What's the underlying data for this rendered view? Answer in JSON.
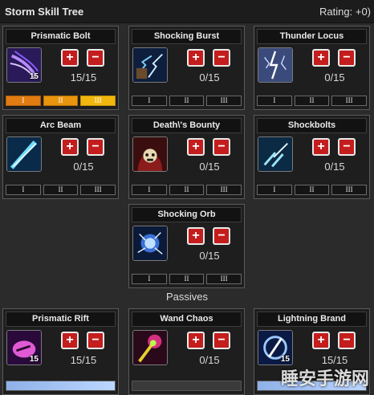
{
  "header": {
    "title": "Storm Skill Tree",
    "rating": "Rating: +0)"
  },
  "skills": [
    {
      "name": "Prismatic Bolt",
      "icon": "prismatic-bolt-icon",
      "level_badge": "15",
      "count": "15/15",
      "ranks": [
        "I",
        "II",
        "III"
      ],
      "ranks_active": [
        true,
        true,
        true
      ]
    },
    {
      "name": "Shocking Burst",
      "icon": "shocking-burst-icon",
      "level_badge": "",
      "count": "0/15",
      "ranks": [
        "I",
        "II",
        "III"
      ],
      "ranks_active": [
        false,
        false,
        false
      ]
    },
    {
      "name": "Thunder Locus",
      "icon": "thunder-locus-icon",
      "level_badge": "",
      "count": "0/15",
      "ranks": [
        "I",
        "II",
        "III"
      ],
      "ranks_active": [
        false,
        false,
        false
      ]
    },
    {
      "name": "Arc Beam",
      "icon": "arc-beam-icon",
      "level_badge": "",
      "count": "0/15",
      "ranks": [
        "I",
        "II",
        "III"
      ],
      "ranks_active": [
        false,
        false,
        false
      ]
    },
    {
      "name": "Death\\'s Bounty",
      "icon": "deaths-bounty-icon",
      "level_badge": "",
      "count": "0/15",
      "ranks": [
        "I",
        "II",
        "III"
      ],
      "ranks_active": [
        false,
        false,
        false
      ]
    },
    {
      "name": "Shockbolts",
      "icon": "shockbolts-icon",
      "level_badge": "",
      "count": "0/15",
      "ranks": [
        "I",
        "II",
        "III"
      ],
      "ranks_active": [
        false,
        false,
        false
      ]
    },
    {
      "name": "Shocking Orb",
      "icon": "shocking-orb-icon",
      "level_badge": "",
      "count": "0/15",
      "ranks": [
        "I",
        "II",
        "III"
      ],
      "ranks_active": [
        false,
        false,
        false
      ]
    }
  ],
  "passives_label": "Passives",
  "passives": [
    {
      "name": "Prismatic Rift",
      "icon": "prismatic-rift-icon",
      "level_badge": "15",
      "count": "15/15",
      "progress": 1.0
    },
    {
      "name": "Wand Chaos",
      "icon": "wand-chaos-icon",
      "level_badge": "",
      "count": "0/15",
      "progress": 0.0
    },
    {
      "name": "Lightning Brand",
      "icon": "lightning-brand-icon",
      "level_badge": "15",
      "count": "15/15",
      "progress": 1.0
    }
  ],
  "buttons": {
    "plus": "+",
    "minus": "−"
  },
  "colors": {
    "button_red": "#c41d1d",
    "rank_orange": "#e07c12",
    "rank_gold": "#f1b70f",
    "passive_fill": "#bcd6ff"
  },
  "watermark": "睡安手游网"
}
